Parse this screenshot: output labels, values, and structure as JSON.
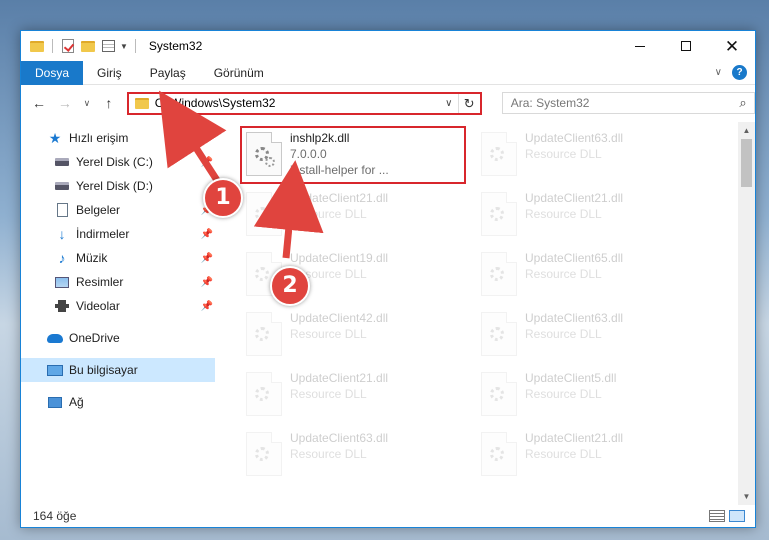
{
  "window": {
    "title": "System32",
    "accent": "#1979ca",
    "highlight_color": "#d8262c"
  },
  "ribbon": {
    "tabs": [
      "Dosya",
      "Giriş",
      "Paylaş",
      "Görünüm"
    ],
    "active_tab": "Dosya"
  },
  "address": {
    "path": "C:\\Windows\\System32",
    "search_placeholder": "Ara: System32"
  },
  "sidebar": {
    "items": [
      {
        "label": "Hızlı erişim",
        "icon": "star-icon"
      },
      {
        "label": "Yerel Disk (C:)",
        "icon": "drive-icon"
      },
      {
        "label": "Yerel Disk (D:)",
        "icon": "drive-icon"
      },
      {
        "label": "Belgeler",
        "icon": "document-icon"
      },
      {
        "label": "İndirmeler",
        "icon": "download-icon"
      },
      {
        "label": "Müzik",
        "icon": "music-icon"
      },
      {
        "label": "Resimler",
        "icon": "pictures-icon"
      },
      {
        "label": "Videolar",
        "icon": "videos-icon"
      },
      {
        "label": "OneDrive",
        "icon": "cloud-icon"
      },
      {
        "label": "Bu bilgisayar",
        "icon": "computer-icon"
      },
      {
        "label": "Ağ",
        "icon": "network-icon"
      }
    ],
    "selected": "Bu bilgisayar"
  },
  "files": {
    "highlighted": {
      "name": "inshlp2k.dll",
      "version": "7.0.0.0",
      "description": "install-helper for ..."
    },
    "faded": [
      {
        "name": "UpdateClient63.dll",
        "type": "Resource DLL"
      },
      {
        "name": "UpdateClient21.dll",
        "type": "Resource DLL"
      },
      {
        "name": "UpdateClient21.dll",
        "type": "Resource DLL"
      },
      {
        "name": "UpdateClient19.dll",
        "type": "Resource DLL"
      },
      {
        "name": "UpdateClient65.dll",
        "type": "Resource DLL"
      },
      {
        "name": "UpdateClient42.dll",
        "type": "Resource DLL"
      },
      {
        "name": "UpdateClient63.dll",
        "type": "Resource DLL"
      },
      {
        "name": "UpdateClient21.dll",
        "type": "Resource DLL"
      },
      {
        "name": "UpdateClient5.dll",
        "type": "Resource DLL"
      },
      {
        "name": "UpdateClient63.dll",
        "type": "Resource DLL"
      },
      {
        "name": "UpdateClient21.dll",
        "type": "Resource DLL"
      }
    ]
  },
  "status": {
    "count": "164 öğe"
  },
  "annotations": {
    "step1": "1",
    "step2": "2"
  }
}
